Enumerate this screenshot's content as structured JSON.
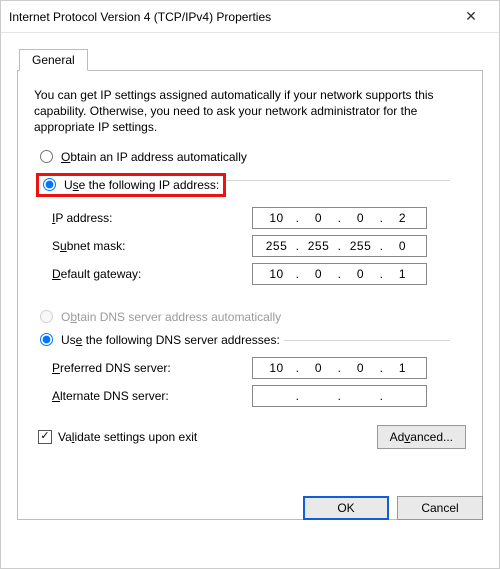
{
  "window": {
    "title": "Internet Protocol Version 4 (TCP/IPv4) Properties"
  },
  "tab": {
    "general": "General"
  },
  "intro": "You can get IP settings assigned automatically if your network supports this capability. Otherwise, you need to ask your network administrator for the appropriate IP settings.",
  "ip": {
    "obtain_auto_label": "Obtain an IP address automatically",
    "obtain_auto_checked": false,
    "use_following_label": "Use the following IP address:",
    "use_following_checked": true,
    "ip_address_label": "IP address:",
    "ip_address": {
      "a": "10",
      "b": "0",
      "c": "0",
      "d": "2"
    },
    "subnet_label": "Subnet mask:",
    "subnet": {
      "a": "255",
      "b": "255",
      "c": "255",
      "d": "0"
    },
    "gateway_label": "Default gateway:",
    "gateway": {
      "a": "10",
      "b": "0",
      "c": "0",
      "d": "1"
    }
  },
  "dns": {
    "obtain_auto_label": "Obtain DNS server address automatically",
    "obtain_auto_enabled": false,
    "use_following_label": "Use the following DNS server addresses:",
    "use_following_checked": true,
    "preferred_label": "Preferred DNS server:",
    "preferred": {
      "a": "10",
      "b": "0",
      "c": "0",
      "d": "1"
    },
    "alternate_label": "Alternate DNS server:",
    "alternate": {
      "a": "",
      "b": "",
      "c": "",
      "d": ""
    }
  },
  "validate": {
    "label": "Validate settings upon exit",
    "checked": true
  },
  "buttons": {
    "advanced": "Advanced...",
    "ok": "OK",
    "cancel": "Cancel"
  }
}
